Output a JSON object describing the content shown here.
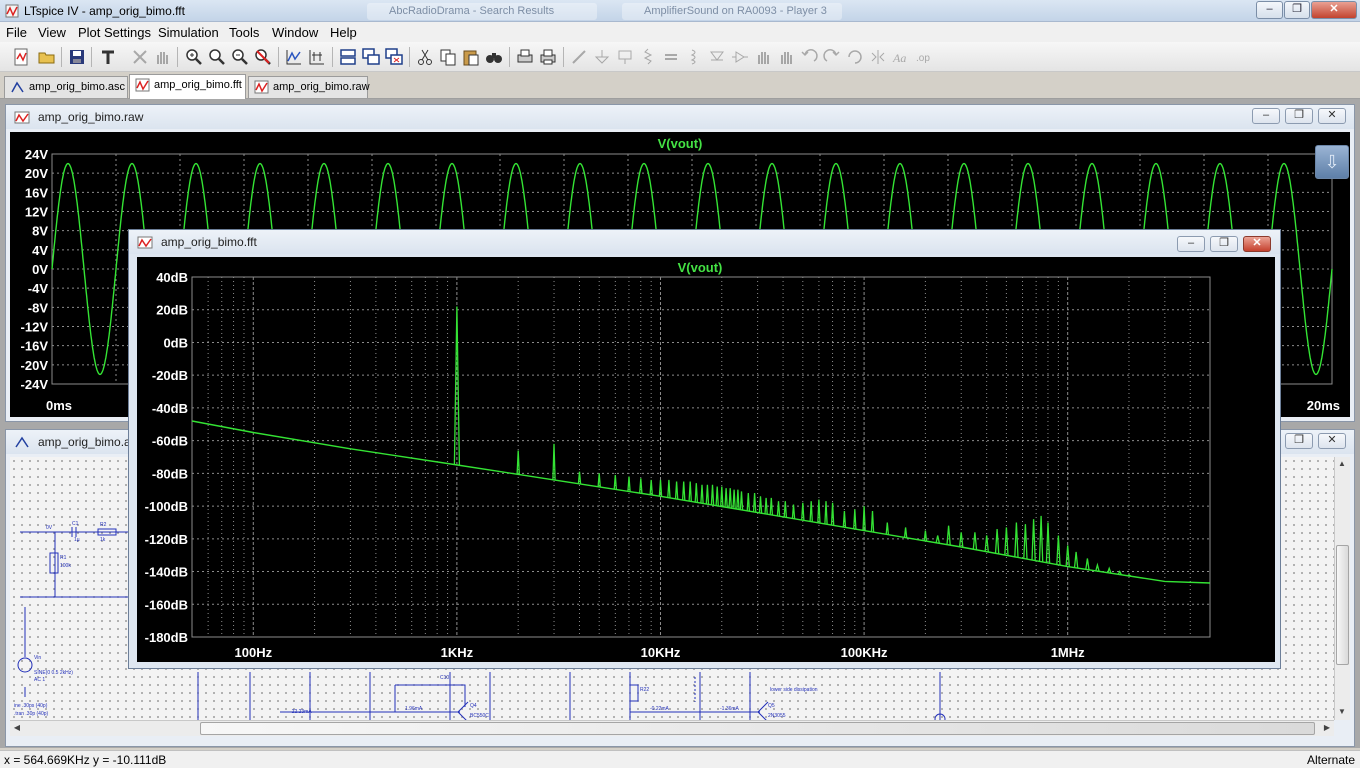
{
  "app": {
    "title": "LTspice IV - amp_orig_bimo.fft",
    "background_tabs": [
      "AbcRadioDrama - Search Results",
      "AmplifierSound on RA0093 - Player 3"
    ]
  },
  "menu": [
    "File",
    "View",
    "Plot Settings",
    "Simulation",
    "Tools",
    "Window",
    "Help"
  ],
  "toolbar_icons": [
    "new-schematic-icon",
    "open-icon",
    "save-icon",
    "control-panel-icon",
    "run-icon",
    "halt-icon",
    "zoom-in-icon",
    "zoom-area-icon",
    "zoom-out-icon",
    "zoom-cancel-icon",
    "autorange-icon",
    "manual-limits-icon",
    "tile-horizontally-icon",
    "cascade-icon",
    "close-all-icon",
    "cut-icon",
    "copy-icon",
    "paste-icon",
    "find-icon",
    "print-preview-icon",
    "print-icon",
    "wire-icon",
    "ground-icon",
    "label-icon",
    "resistor-icon",
    "capacitor-icon",
    "inductor-icon",
    "diode-icon",
    "component-icon",
    "move-icon",
    "drag-icon",
    "undo-icon",
    "redo-icon",
    "rotate-icon",
    "mirror-icon",
    "text-icon",
    "spice-directive-icon"
  ],
  "tabs": [
    {
      "label": "amp_orig_bimo.asc",
      "icon": "schematic-icon",
      "active": false
    },
    {
      "label": "amp_orig_bimo.fft",
      "icon": "waveform-icon",
      "active": true
    },
    {
      "label": "amp_orig_bimo.raw",
      "icon": "waveform-icon",
      "active": false
    }
  ],
  "windows": {
    "raw": {
      "title": "amp_orig_bimo.raw"
    },
    "asc": {
      "title": "amp_orig_bimo.asc"
    },
    "fft": {
      "title": "amp_orig_bimo.fft"
    }
  },
  "schematic_labels": [
    "0V",
    "C1",
    "1µ",
    "R2",
    "1k",
    "R1",
    "100k",
    "Vin",
    "SINE(0 0.5 2kHz)",
    "AC 1",
    "C10",
    "R22",
    "Q4",
    "Q5",
    "BC550C",
    "2N3055",
    "lower side dissipation",
    "-22.23mA",
    "1.96mA",
    "-0.22mA",
    "-1.36mA",
    "ine .30ps (40p)",
    ".tran .30p (40p)"
  ],
  "colors": {
    "trace": "#34e334",
    "plot_bg": "#000000",
    "grid": "#8c8c8c",
    "axis_text": "#ffffff",
    "trace_label": "#44e244"
  },
  "status": {
    "cursor_x": "x = 564.669KHz",
    "cursor_y": "y = -10.111dB",
    "mode": "Alternate"
  },
  "chart_data": [
    {
      "type": "line",
      "name": "time-domain",
      "title": "V(vout)",
      "xlabel": "",
      "ylabel": "",
      "x_range_ms": [
        0,
        20
      ],
      "x_tick_labels": [
        "0ms",
        "20ms"
      ],
      "y_ticks": [
        "24V",
        "20V",
        "16V",
        "12V",
        "8V",
        "4V",
        "0V",
        "-4V",
        "-8V",
        "-12V",
        "-16V",
        "-20V",
        "-24V"
      ],
      "ylim": [
        -24,
        24
      ],
      "series": [
        {
          "name": "V(vout)",
          "waveform": "sine",
          "amplitude_v": 22,
          "frequency_hz": 1000,
          "cycles_visible": 20
        }
      ]
    },
    {
      "type": "line",
      "name": "fft",
      "title": "V(vout)",
      "xlabel": "",
      "ylabel": "",
      "x_scale": "log",
      "xlim_hz": [
        50,
        5000000
      ],
      "x_tick_labels": [
        "100Hz",
        "1KHz",
        "10KHz",
        "100KHz",
        "1MHz"
      ],
      "x_ticks_hz": [
        100,
        1000,
        10000,
        100000,
        1000000
      ],
      "ylim": [
        -180,
        40
      ],
      "y_ticks": [
        "40dB",
        "20dB",
        "0dB",
        "-20dB",
        "-40dB",
        "-60dB",
        "-80dB",
        "-100dB",
        "-120dB",
        "-140dB",
        "-160dB",
        "-180dB"
      ],
      "noise_floor": [
        [
          50,
          -48
        ],
        [
          100,
          -55
        ],
        [
          300,
          -65
        ],
        [
          900,
          -74
        ],
        [
          3000,
          -84
        ],
        [
          10000,
          -94
        ],
        [
          30000,
          -104
        ],
        [
          100000,
          -115
        ],
        [
          300000,
          -125
        ],
        [
          1000000,
          -137
        ],
        [
          3000000,
          -146
        ],
        [
          5000000,
          -147
        ]
      ],
      "harmonics": [
        {
          "f": 1000,
          "db": 22
        },
        {
          "f": 2000,
          "db": -66
        },
        {
          "f": 3000,
          "db": -62
        },
        {
          "f": 4000,
          "db": -79
        },
        {
          "f": 5000,
          "db": -80
        },
        {
          "f": 6000,
          "db": -81
        },
        {
          "f": 7000,
          "db": -82
        },
        {
          "f": 8000,
          "db": -83
        },
        {
          "f": 9000,
          "db": -84
        },
        {
          "f": 10000,
          "db": -84
        },
        {
          "f": 11000,
          "db": -84
        },
        {
          "f": 12000,
          "db": -85
        },
        {
          "f": 13000,
          "db": -85
        },
        {
          "f": 14000,
          "db": -85
        },
        {
          "f": 15000,
          "db": -86
        },
        {
          "f": 16000,
          "db": -87
        },
        {
          "f": 17000,
          "db": -87
        },
        {
          "f": 18000,
          "db": -87
        },
        {
          "f": 19000,
          "db": -88
        },
        {
          "f": 20000,
          "db": -88
        },
        {
          "f": 21000,
          "db": -89
        },
        {
          "f": 22000,
          "db": -89
        },
        {
          "f": 23000,
          "db": -90
        },
        {
          "f": 24000,
          "db": -90
        },
        {
          "f": 25000,
          "db": -91
        },
        {
          "f": 27000,
          "db": -92
        },
        {
          "f": 29000,
          "db": -92
        },
        {
          "f": 31000,
          "db": -94
        },
        {
          "f": 33000,
          "db": -95
        },
        {
          "f": 35000,
          "db": -95
        },
        {
          "f": 38000,
          "db": -97
        },
        {
          "f": 41000,
          "db": -97
        },
        {
          "f": 45000,
          "db": -99
        },
        {
          "f": 50000,
          "db": -98
        },
        {
          "f": 55000,
          "db": -97
        },
        {
          "f": 60000,
          "db": -96
        },
        {
          "f": 65000,
          "db": -97
        },
        {
          "f": 70000,
          "db": -98
        },
        {
          "f": 80000,
          "db": -103
        },
        {
          "f": 90000,
          "db": -102
        },
        {
          "f": 100000,
          "db": -100
        },
        {
          "f": 110000,
          "db": -103
        },
        {
          "f": 130000,
          "db": -110
        },
        {
          "f": 160000,
          "db": -113
        },
        {
          "f": 200000,
          "db": -115
        },
        {
          "f": 230000,
          "db": -118
        },
        {
          "f": 260000,
          "db": -112
        },
        {
          "f": 300000,
          "db": -116
        },
        {
          "f": 350000,
          "db": -116
        },
        {
          "f": 400000,
          "db": -118
        },
        {
          "f": 450000,
          "db": -114
        },
        {
          "f": 500000,
          "db": -113
        },
        {
          "f": 560000,
          "db": -110
        },
        {
          "f": 620000,
          "db": -111
        },
        {
          "f": 680000,
          "db": -108
        },
        {
          "f": 740000,
          "db": -106
        },
        {
          "f": 800000,
          "db": -110
        },
        {
          "f": 900000,
          "db": -118
        },
        {
          "f": 1000000,
          "db": -124
        },
        {
          "f": 1100000,
          "db": -128
        },
        {
          "f": 1250000,
          "db": -132
        },
        {
          "f": 1400000,
          "db": -136
        },
        {
          "f": 1600000,
          "db": -138
        },
        {
          "f": 1800000,
          "db": -140
        },
        {
          "f": 2000000,
          "db": -142
        }
      ]
    }
  ]
}
